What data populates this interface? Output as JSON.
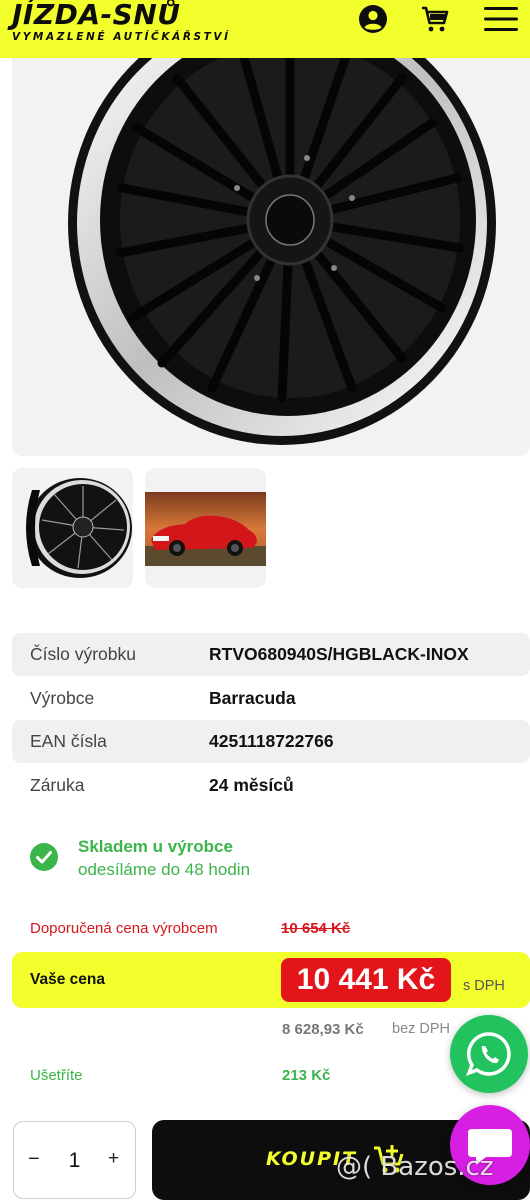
{
  "header": {
    "logo_main": "JÍZDA-SNŮ",
    "logo_sub": "VYMAZLENÉ AUTÍČKÁŘSTVÍ",
    "icons": [
      "user-icon",
      "cart-icon",
      "menu-icon"
    ],
    "accent_color": "#f3ff2c"
  },
  "gallery": {
    "main_image": "black multi-spoke alloy wheel with polished lip",
    "thumbnails": [
      "wheel-thumbnail",
      "red-car-thumbnail"
    ]
  },
  "specs": [
    {
      "label": "Číslo výrobku",
      "value": "RTVO680940S/HGBLACK-INOX"
    },
    {
      "label": "Výrobce",
      "value": "Barracuda"
    },
    {
      "label": "EAN čísla",
      "value": "4251118722766"
    },
    {
      "label": "Záruka",
      "value": "24 měsíců"
    }
  ],
  "stock": {
    "title": "Skladem u výrobce",
    "subtitle": "odesíláme do 48 hodin",
    "color": "#3bb44a"
  },
  "pricing": {
    "rrp_label": "Doporučená cena výrobcem",
    "rrp_value": "10 654 Kč",
    "your_price_label": "Vaše cena",
    "your_price_value": "10 441 Kč",
    "with_vat_label": "s DPH",
    "net_price_value": "8 628,93 Kč",
    "net_price_label": "bez DPH",
    "savings_label": "Ušetříte",
    "savings_value": "213 Kč",
    "price_color": "#e4141b"
  },
  "purchase": {
    "minus": "−",
    "quantity": "1",
    "plus": "+",
    "buy_label": "KOUPIT"
  },
  "floating": {
    "whatsapp_icon": "whatsapp-icon",
    "chat_icon": "chat-icon"
  },
  "watermark": "@( Bazos.cz"
}
